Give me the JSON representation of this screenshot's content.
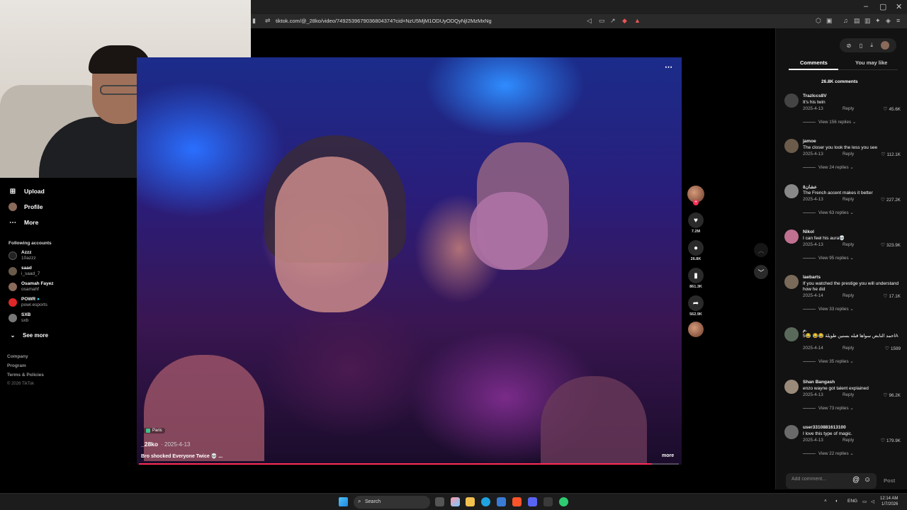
{
  "browser": {
    "url": "tiktok.com/@_28ko/video/7492539679036804374?cid=NzU5MjM1ODUyODQyNjI2MzMxNg",
    "window_controls": [
      "–",
      "▢",
      "✕"
    ]
  },
  "sidebar": {
    "nav": [
      {
        "label": "Upload",
        "icon": "upload-icon"
      },
      {
        "label": "Profile",
        "icon": "profile-avatar"
      },
      {
        "label": "More",
        "icon": "more-icon"
      }
    ],
    "following_title": "Following accounts",
    "following": [
      {
        "name": "Azzz",
        "handle": "10azzz"
      },
      {
        "name": "saad",
        "handle": "i_saad_7"
      },
      {
        "name": "Osamah Fayez",
        "handle": "osamahf"
      },
      {
        "name": "POWR",
        "handle": "powr.esports"
      },
      {
        "name": "SXB",
        "handle": "sxb"
      }
    ],
    "see_more": "See more",
    "footer": [
      "Company",
      "Program",
      "Terms & Policies"
    ],
    "copyright": "© 2026 TikTok"
  },
  "video": {
    "location": "Paris",
    "author": "_28ko",
    "date": "2025-4-13",
    "caption": "Bro shocked Everyone Twice 💀 ...",
    "more_label": "more",
    "progress": 0.95,
    "more_dots": "⋯"
  },
  "actions": {
    "likes": "7.2M",
    "comments": "26.8K",
    "saves": "861.3K",
    "shares": "562.9K"
  },
  "panel": {
    "tabs": [
      "Comments",
      "You may like"
    ],
    "comment_count": "26.8K comments",
    "reply_label": "Reply",
    "comments": [
      {
        "name": "TrazIccs8V",
        "text": "It's his twin",
        "date": "2025-4-13",
        "likes": "45.6K",
        "replies": "View 156 replies"
      },
      {
        "name": "jamoe",
        "text": "The closer you look the less you see",
        "date": "2025-4-13",
        "likes": "112.1K",
        "replies": "View 24 replies"
      },
      {
        "name": "عشان٥",
        "text": "The French accent makes it better",
        "date": "2025-4-13",
        "likes": "227.2K",
        "replies": "View 63 replies"
      },
      {
        "name": "Nikol",
        "text": "I can feel his aura💀",
        "date": "2025-4-13",
        "likes": "323.9K",
        "replies": "View 95 replies"
      },
      {
        "name": "laebarts",
        "text": "If you watched the prestige you will understand how he did",
        "date": "2025-4-14",
        "likes": "17.1K",
        "replies": "View 33 replies"
      },
      {
        "name": "م.",
        "text": "احمد النابض سواها قبله بسنين طويلة 😂😂 😂5A",
        "date": "2025-4-14",
        "likes": "1599",
        "replies": "View 35 replies"
      },
      {
        "name": "Shan Bangash",
        "text": "enzo wayne got talent explained",
        "date": "2025-4-13",
        "likes": "96.2K",
        "replies": "View 73 replies"
      },
      {
        "name": "user3310881613100",
        "text": "I love this type of magic.",
        "date": "2025-4-13",
        "likes": "179.9K",
        "replies": "View 22 replies"
      }
    ],
    "add_comment_placeholder": "Add comment...",
    "post_label": "Post"
  },
  "taskbar": {
    "search_label": "Search",
    "lang": "ENG",
    "time": "12:14 AM",
    "date": "1/7/2026"
  },
  "colors": {
    "accent": "#fe2c55",
    "panel_bg": "#121212"
  }
}
